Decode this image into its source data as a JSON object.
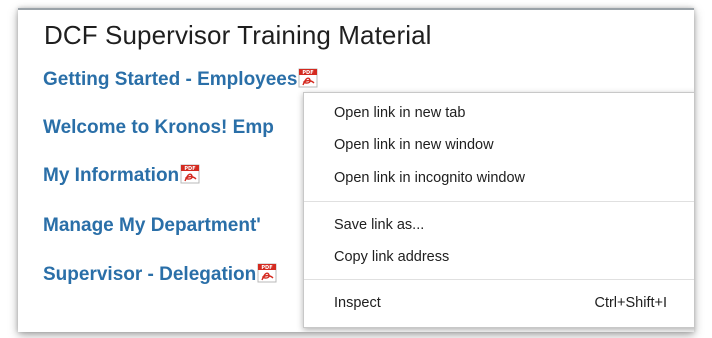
{
  "page": {
    "title": "DCF Supervisor Training Material"
  },
  "links": [
    {
      "label": "Getting Started - Employees",
      "icon": "pdf-icon"
    },
    {
      "label": "Welcome to Kronos! Emp",
      "icon": "pdf-icon"
    },
    {
      "label": "My Information",
      "icon": "pdf-icon"
    },
    {
      "label": "Manage My Department'",
      "icon": "pdf-icon"
    },
    {
      "label": "Supervisor - Delegation",
      "icon": "pdf-icon"
    }
  ],
  "context_menu": {
    "items": [
      {
        "label": "Open link in new tab"
      },
      {
        "label": "Open link in new window"
      },
      {
        "label": "Open link in incognito window"
      },
      {
        "label": "Save link as..."
      },
      {
        "label": "Copy link address"
      },
      {
        "label": "Inspect",
        "shortcut": "Ctrl+Shift+I"
      }
    ]
  },
  "colors": {
    "link": "#2a6fa8",
    "title": "#1f1f1f",
    "pdf_icon": "#d42a20"
  }
}
